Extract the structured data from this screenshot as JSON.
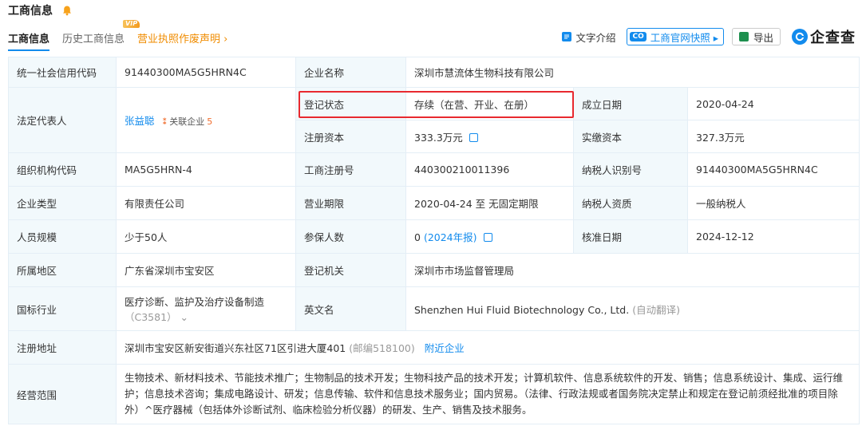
{
  "header": {
    "title": "工商信息"
  },
  "tabs": [
    {
      "label": "工商信息"
    },
    {
      "label": "历史工商信息"
    },
    {
      "label": "营业执照作废声明 ›",
      "badge": "VIP"
    }
  ],
  "toolbar": {
    "text_intro": "文字介绍",
    "snapshot_badge": "CO",
    "snapshot": "工商官网快照 ▸",
    "export": "导出",
    "logo": "企查查"
  },
  "fields": {
    "credit_code_label": "统一社会信用代码",
    "credit_code": "91440300MA5G5HRN4C",
    "company_name_label": "企业名称",
    "company_name": "深圳市慧流体生物科技有限公司",
    "legal_rep_label": "法定代表人",
    "legal_rep": "张益聪",
    "related_label": "关联企业",
    "related_count": "5",
    "reg_status_label": "登记状态",
    "reg_status": "存续（在营、开业、在册）",
    "found_date_label": "成立日期",
    "found_date": "2020-04-24",
    "reg_capital_label": "注册资本",
    "reg_capital": "333.3万元",
    "paid_capital_label": "实缴资本",
    "paid_capital": "327.3万元",
    "org_code_label": "组织机构代码",
    "org_code": "MA5G5HRN-4",
    "biz_reg_no_label": "工商注册号",
    "biz_reg_no": "440300210011396",
    "taxpayer_id_label": "纳税人识别号",
    "taxpayer_id": "91440300MA5G5HRN4C",
    "company_type_label": "企业类型",
    "company_type": "有限责任公司",
    "biz_term_label": "营业期限",
    "biz_term": "2020-04-24 至 无固定期限",
    "taxpayer_qual_label": "纳税人资质",
    "taxpayer_qual": "一般纳税人",
    "staff_size_label": "人员规模",
    "staff_size": "少于50人",
    "insured_label": "参保人数",
    "insured": "0",
    "insured_year": "(2024年报)",
    "approve_date_label": "核准日期",
    "approve_date": "2024-12-12",
    "region_label": "所属地区",
    "region": "广东省深圳市宝安区",
    "authority_label": "登记机关",
    "authority": "深圳市市场监督管理局",
    "industry_label": "国标行业",
    "industry": "医疗诊断、监护及治疗设备制造",
    "industry_code": "（C3581）",
    "english_name_label": "英文名",
    "english_name": "Shenzhen Hui Fluid Biotechnology Co., Ltd.",
    "english_note": "(自动翻译)",
    "address_label": "注册地址",
    "address": "深圳市宝安区新安街道兴东社区71区引进大厦401",
    "postcode": "(邮编518100)",
    "nearby": "附近企业",
    "scope_label": "经营范围",
    "scope": "生物技术、新材料技术、节能技术推广；生物制品的技术开发；生物科技产品的技术开发；计算机软件、信息系统软件的开发、销售；信息系统设计、集成、运行维护；信息技术咨询；集成电路设计、研发；信息传输、软件和信息技术服务业；国内贸易。（法律、行政法规或者国务院决定禁止和规定在登记前须经批准的项目除外）^医疗器械（包括体外诊断试剂、临床检验分析仪器）的研发、生产、销售及技术服务。"
  },
  "colors": {
    "accent": "#128bed",
    "highlight": "#e8292f",
    "label_bg": "#f2f9fc",
    "vip": "#f08c00"
  }
}
